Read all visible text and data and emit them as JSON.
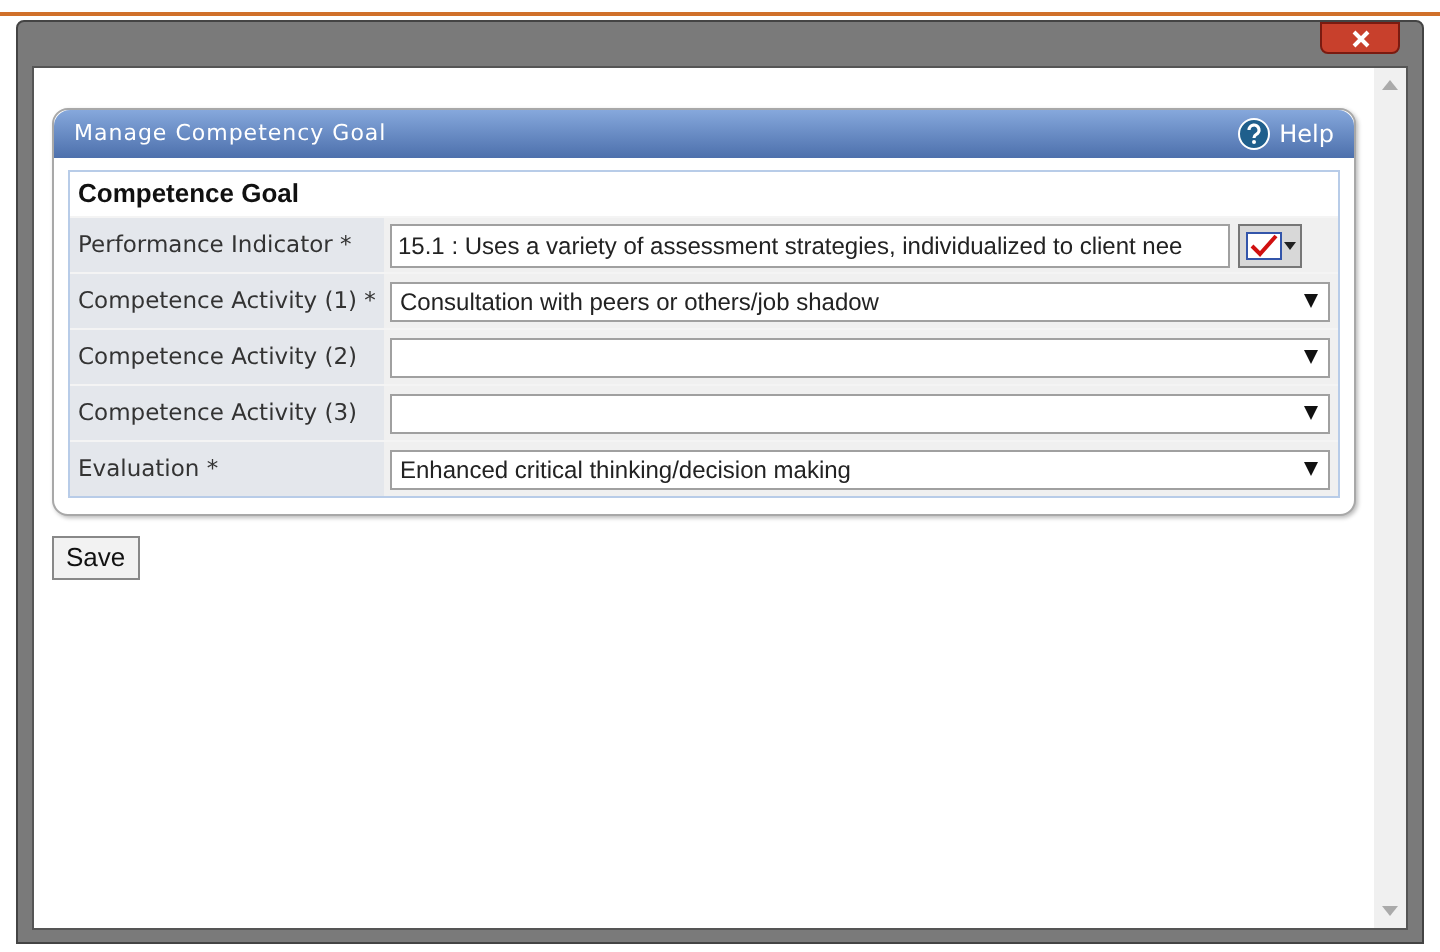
{
  "panel": {
    "title": "Manage Competency Goal",
    "help": "Help"
  },
  "section": "Competence Goal",
  "fields": [
    {
      "label": "Performance Indicator *",
      "kind": "text",
      "value": "15.1 : Uses a variety of assessment strategies, individualized to client nee"
    },
    {
      "label": "Competence Activity (1) *",
      "kind": "select",
      "value": "Consultation with peers or others/job shadow"
    },
    {
      "label": "Competence Activity (2)",
      "kind": "select"
    },
    {
      "label": "Competence Activity (3)",
      "kind": "select"
    },
    {
      "label": "Evaluation *",
      "kind": "select",
      "value": "Enhanced critical thinking/decision making"
    }
  ],
  "buttons": [
    "Save"
  ]
}
